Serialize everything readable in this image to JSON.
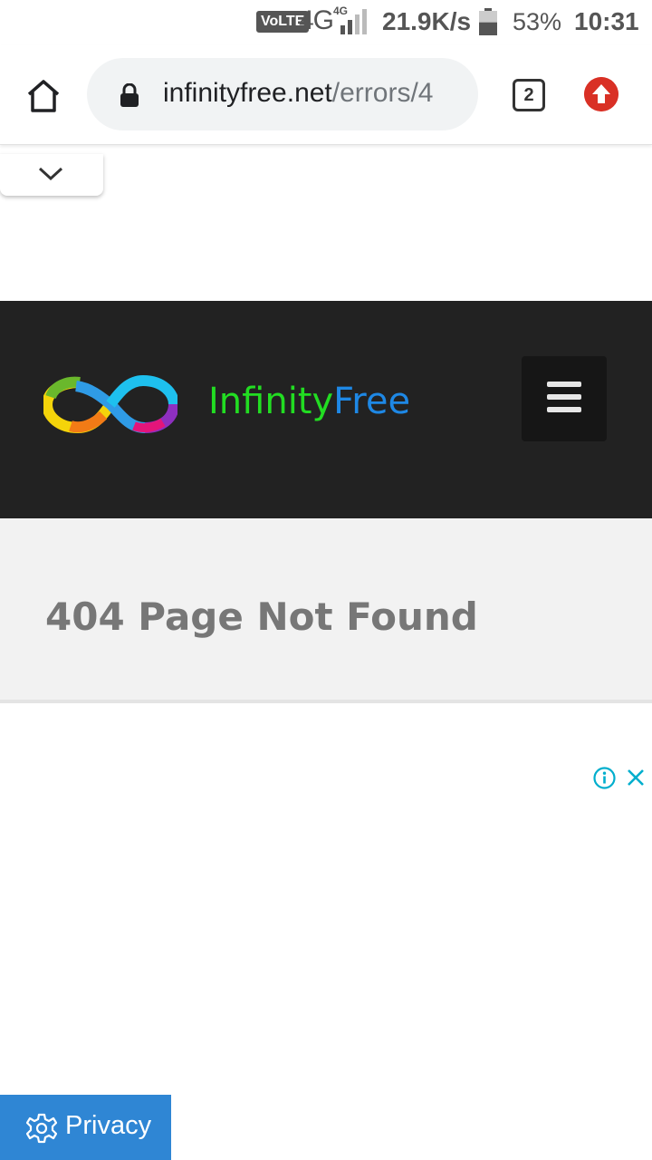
{
  "status_bar": {
    "volte": "VoLTE",
    "network": "4G",
    "network_small": "4G",
    "speed": "21.9K/s",
    "battery_percent": "53%",
    "battery_level": 0.53,
    "time": "10:31"
  },
  "browser": {
    "url_host": "infinityfree.net",
    "url_path": "/errors/4",
    "tab_count": "2"
  },
  "site": {
    "logo_word1": "Infinity",
    "logo_word2": "Free",
    "colors": {
      "header_bg": "#222222",
      "logo_green": "#22dd22",
      "logo_blue": "#1e88e5"
    }
  },
  "page": {
    "title": "404 Page Not Found"
  },
  "ad": {
    "info_icon": "info-icon",
    "close_icon": "close-icon"
  },
  "privacy": {
    "label": "Privacy",
    "icon": "gear-icon",
    "color": "#2f86d4"
  }
}
